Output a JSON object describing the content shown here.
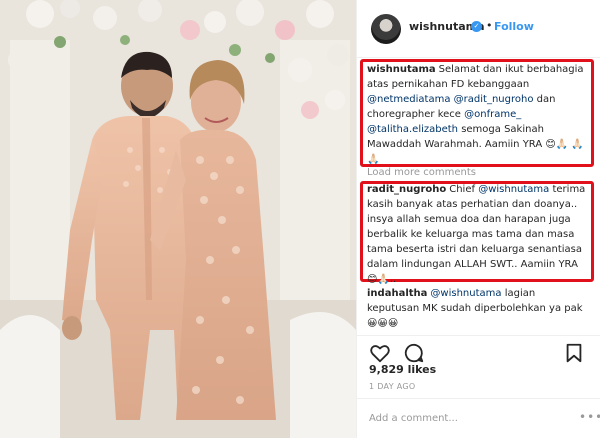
{
  "post": {
    "username": "wishnutama",
    "separator": "•",
    "follow_label": "Follow",
    "verified_glyph": "✓"
  },
  "comments": [
    {
      "username": "wishnutama",
      "parts": [
        {
          "text": "Selamat dan ikut berbahagia atas pernikahan FD kebanggaan ",
          "mention": false
        },
        {
          "text": "@netmediatama",
          "mention": true
        },
        {
          "text": " ",
          "mention": false
        },
        {
          "text": "@radit_nugroho",
          "mention": true
        },
        {
          "text": " dan choregrapher kece ",
          "mention": false
        },
        {
          "text": "@onframe_",
          "mention": true
        },
        {
          "text": " ",
          "mention": false
        },
        {
          "text": "@talitha.elizabeth",
          "mention": true
        },
        {
          "text": " semoga Sakinah Mawaddah Warahmah. Aamiin YRA 😊🙏🏻 🙏🏻🙏🏻",
          "mention": false
        }
      ]
    },
    {
      "username": "radit_nugroho",
      "parts": [
        {
          "text": "Chief ",
          "mention": false
        },
        {
          "text": "@wishnutama",
          "mention": true
        },
        {
          "text": " terima kasih banyak atas perhatian dan doanya.. insya allah semua doa dan harapan juga berbalik ke keluarga mas tama dan masa tama beserta istri dan keluarga senantiasa dalam lindungan ALLAH SWT.. Aamiin YRA 😊🙏🏻..",
          "mention": false
        }
      ]
    },
    {
      "username": "indahaltha",
      "parts": [
        {
          "text": "@wishnutama",
          "mention": true
        },
        {
          "text": " lagian keputusan MK sudah diperbolehkan ya pak 😀😀😀",
          "mention": false
        }
      ]
    }
  ],
  "load_more_label": "Load more comments",
  "actions": {
    "like_icon": "heart-icon",
    "comment_icon": "comment-icon",
    "save_icon": "bookmark-icon"
  },
  "likes_text": "9,829 likes",
  "timestamp": "1 DAY AGO",
  "add_comment": {
    "placeholder": "Add a comment..."
  },
  "more_options": "•••",
  "colors": {
    "highlight": "#e2101a",
    "link": "#3897f0",
    "mention": "#003569"
  }
}
